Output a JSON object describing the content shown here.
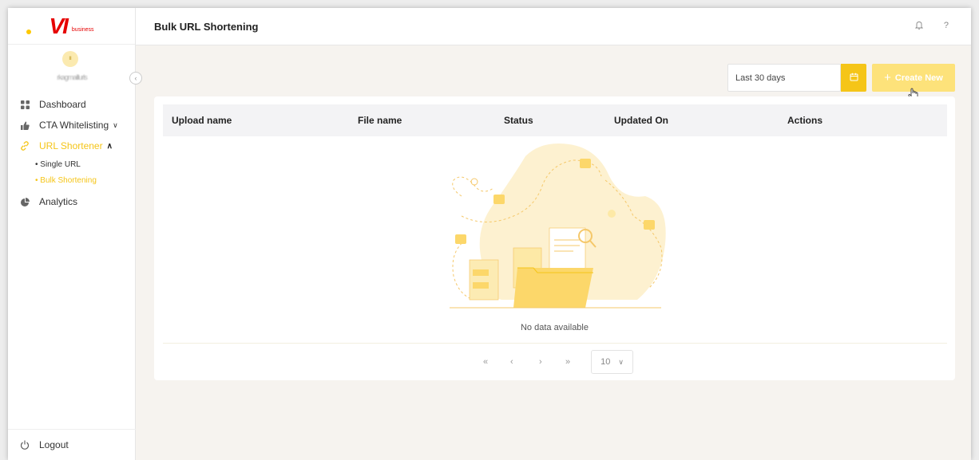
{
  "app": {
    "logo_text": "VI",
    "logo_sub": "business",
    "user_initial": "II",
    "user_name": "rkagmaillurls"
  },
  "sidebar": {
    "items": [
      {
        "label": "Dashboard",
        "icon": "grid-icon"
      },
      {
        "label": "CTA Whitelisting",
        "icon": "thumbs-up-icon"
      },
      {
        "label": "URL Shortener",
        "icon": "link-icon"
      },
      {
        "label": "Analytics",
        "icon": "pie-chart-icon"
      }
    ],
    "subitems": [
      {
        "label": "• Single URL"
      },
      {
        "label": "• Bulk Shortening"
      }
    ],
    "logout_label": "Logout"
  },
  "header": {
    "title": "Bulk URL Shortening"
  },
  "toolbar": {
    "date_range": "Last 30 days",
    "create_label": "Create New"
  },
  "table": {
    "columns": [
      "Upload name",
      "File name",
      "Status",
      "Updated On",
      "Actions"
    ],
    "empty_text": "No data available"
  },
  "pagination": {
    "first": "«",
    "prev": "‹",
    "next": "›",
    "last": "»",
    "page_size": "10"
  },
  "colors": {
    "accent": "#f5c518",
    "brand_red": "#e60000",
    "create_button": "#fde27a",
    "background": "#f6f3ef"
  }
}
